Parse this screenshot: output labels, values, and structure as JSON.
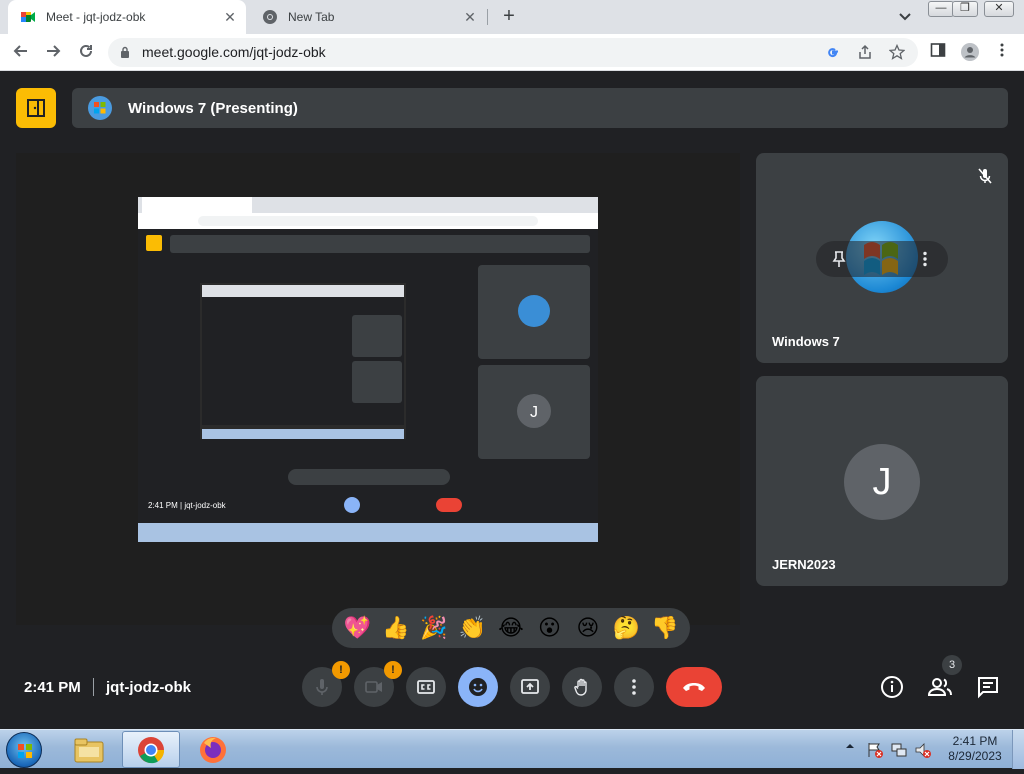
{
  "browser": {
    "tabs": [
      {
        "title": "Meet - jqt-jodz-obk",
        "active": true
      },
      {
        "title": "New Tab",
        "active": false
      }
    ],
    "url": "meet.google.com/jqt-jodz-obk"
  },
  "meet": {
    "presenting_text": "Windows 7 (Presenting)",
    "participants": [
      {
        "name": "Windows 7",
        "muted": true
      },
      {
        "name": "JERN2023",
        "initial": "J"
      }
    ],
    "reactions": [
      "💖",
      "👍",
      "🎉",
      "👏",
      "😂",
      "😮",
      "😢",
      "🤔",
      "👎"
    ],
    "clock": "2:41 PM",
    "meeting_code": "jqt-jodz-obk",
    "mic_badge": "!",
    "camera_badge": "!",
    "participant_count": "3"
  },
  "taskbar": {
    "time": "2:41 PM",
    "date": "8/29/2023"
  },
  "colors": {
    "meet_bg": "#202124",
    "surface": "#3c4043",
    "exit_yellow": "#fbbc04",
    "end_call_red": "#ea4335",
    "active_blue": "#8ab4f8",
    "warning_badge": "#f29900"
  }
}
